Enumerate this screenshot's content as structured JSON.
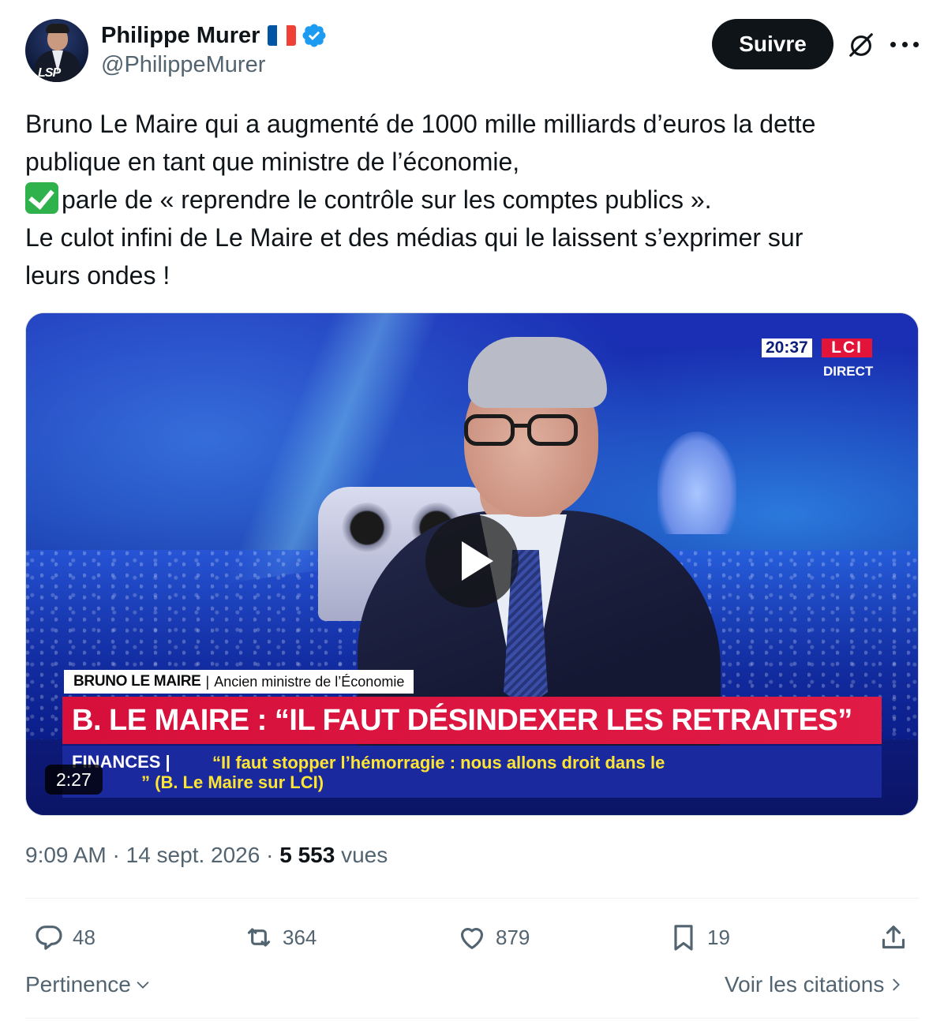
{
  "author": {
    "name": "Philippe Murer",
    "handle": "@PhilippeMurer",
    "avatar_logo": "LSP",
    "flag_colors": [
      "#0055a4",
      "#ffffff",
      "#ef4135"
    ],
    "verified_color": "#1d9bf0"
  },
  "header": {
    "follow_label": "Suivre",
    "grok_icon": "grok-icon",
    "more_icon": "more-icon"
  },
  "tweet": {
    "lines": [
      "Bruno Le Maire qui a augmenté de 1000 mille milliards d’euros la dette",
      "publique en tant que ministre de l’économie,",
      "parle de « reprendre le contrôle sur les  comptes publics ».",
      "Le culot infini de Le Maire et des médias qui le laissent s’exprimer sur",
      "leurs ondes !"
    ],
    "check_emoji": "✅"
  },
  "video": {
    "clock": "20:37",
    "channel": "LCI",
    "live_label": "DIRECT",
    "lower_third_name": "BRUNO LE MAIRE",
    "lower_third_title": "Ancien ministre de l’Économie",
    "headline": "B. LE MAIRE : “IL FAUT DÉSINDEXER LES RETRAITES”",
    "ticker_tag": "FINANCES |",
    "ticker_line1": "“Il faut stopper l’hémorragie : nous allons droit dans le",
    "ticker_line2": "” (B. Le Maire sur LCI)",
    "duration": "2:27",
    "play_icon": "play-icon"
  },
  "meta": {
    "time": "9:09 AM",
    "sep1": " · ",
    "date": "14 sept. 2026",
    "sep2": " · ",
    "views_count": "5 553",
    "views_label": "vues"
  },
  "actions": {
    "replies": "48",
    "reposts": "364",
    "likes": "879",
    "bookmarks": "19"
  },
  "footer": {
    "sort_label": "Pertinence",
    "quotes_label": "Voir les citations"
  }
}
